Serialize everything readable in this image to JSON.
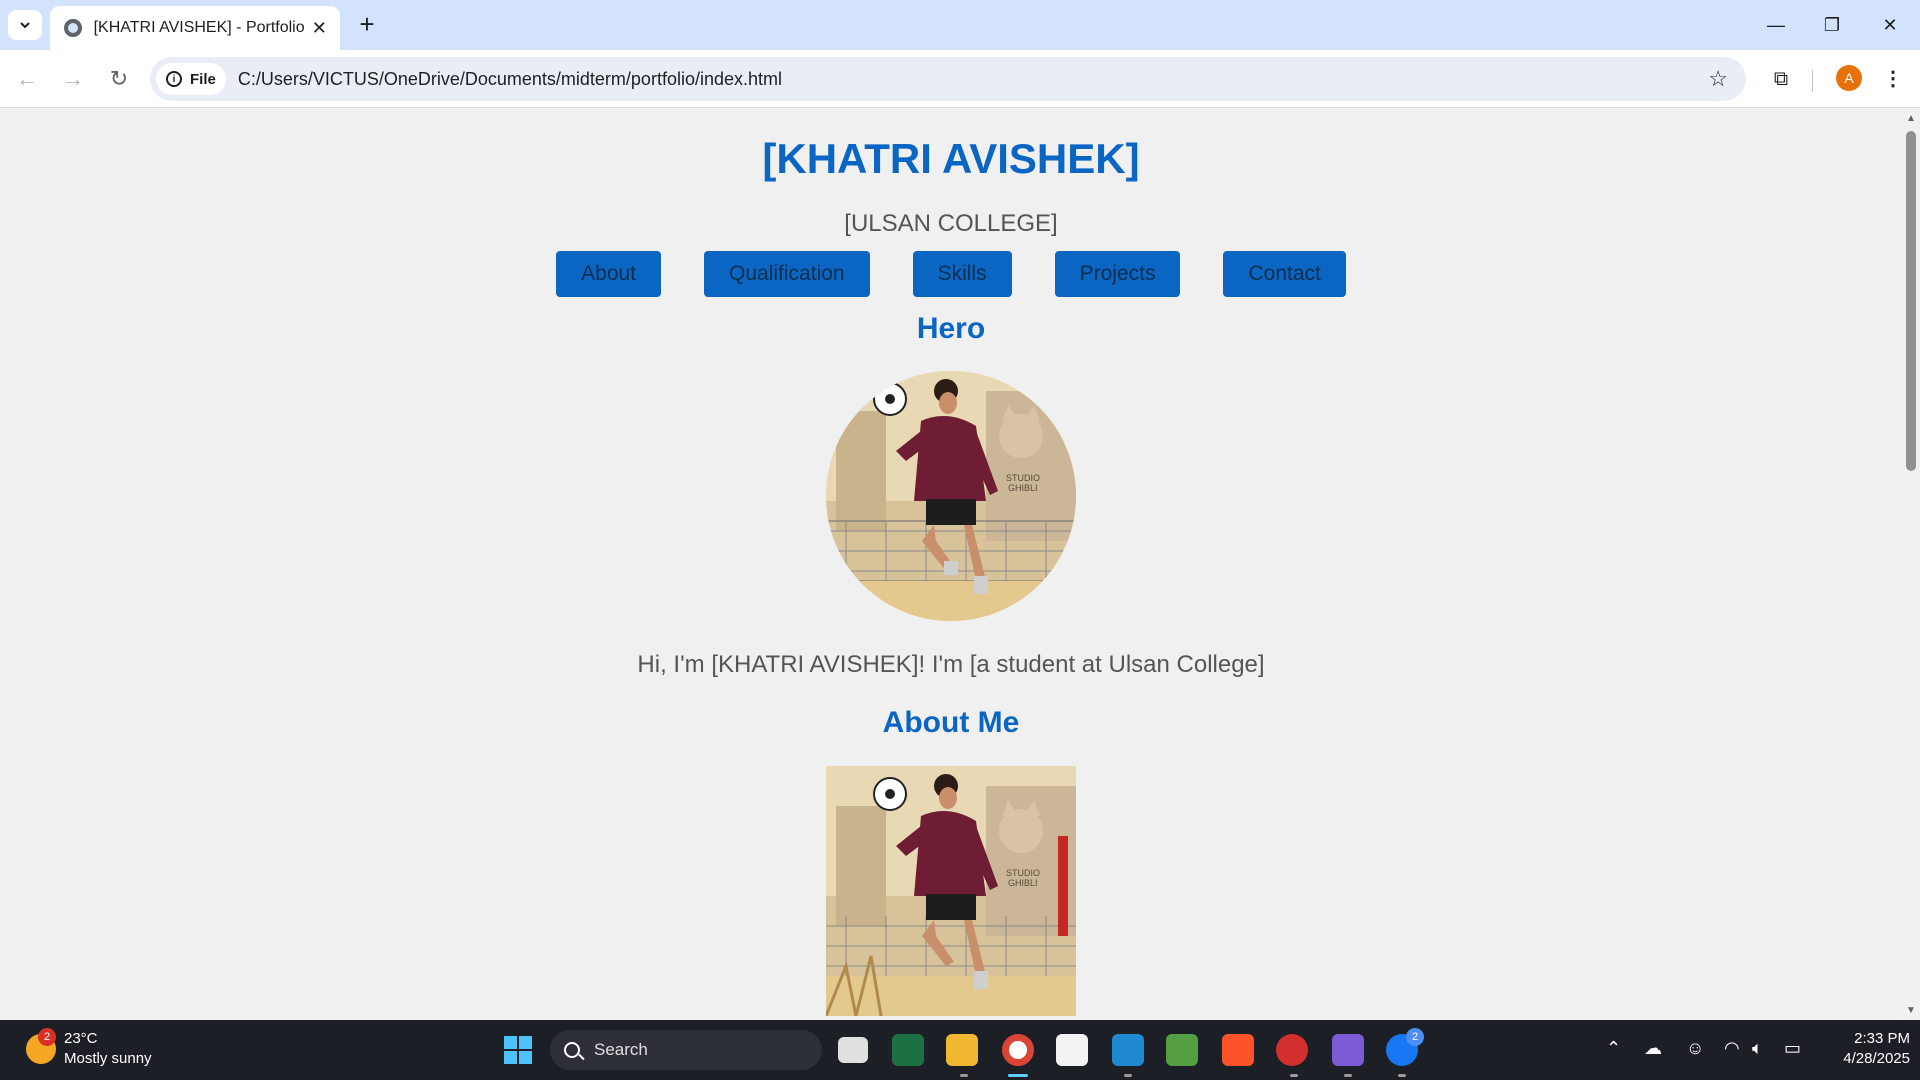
{
  "browser": {
    "tab_title": "[KHATRI AVISHEK] - Portfolio",
    "address_chip": "File",
    "url": "C:/Users/VICTUS/OneDrive/Documents/midterm/portfolio/index.html",
    "profile_initial": "A"
  },
  "page": {
    "title": "[KHATRI AVISHEK]",
    "subtitle": "[ULSAN COLLEGE]",
    "nav": [
      "About",
      "Qualification",
      "Skills",
      "Projects",
      "Contact"
    ],
    "hero_heading": "Hero",
    "intro": "Hi, I'm [KHATRI AVISHEK]! I'm [a student at Ulsan College]",
    "about_heading": "About Me",
    "image_sign": "STUDIO GHIBLI"
  },
  "taskbar": {
    "weather_temp": "23°C",
    "weather_desc": "Mostly sunny",
    "weather_badge": "2",
    "search_label": "Search",
    "messenger_badge": "2",
    "time": "2:33 PM",
    "date": "4/28/2025"
  },
  "colors": {
    "accent": "#0a66c2",
    "tab_strip": "#d3e3fd",
    "taskbar": "#1c1f26"
  }
}
